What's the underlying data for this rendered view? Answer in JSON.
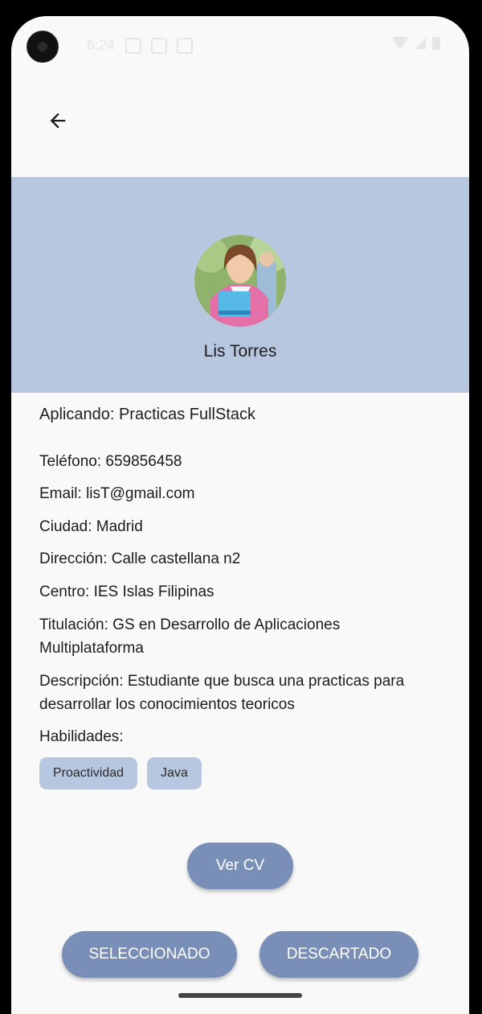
{
  "status_bar": {
    "time": "6:24"
  },
  "profile": {
    "name": "Lis Torres",
    "applying": "Aplicando: Practicas FullStack"
  },
  "details": {
    "phone": "Teléfono: 659856458",
    "email": "Email: lisT@gmail.com",
    "city": "Ciudad: Madrid",
    "address": "Dirección: Calle castellana n2",
    "center": "Centro: IES Islas Filipinas",
    "degree": "Titulación: GS en Desarrollo de Aplicaciones Multiplataforma",
    "description": "Descripción: Estudiante que busca una practicas para desarrollar los conocimientos teoricos",
    "skills_label": "Habilidades:"
  },
  "skills": [
    "Proactividad",
    "Java"
  ],
  "actions": {
    "view_cv": "Ver CV",
    "selected": "SELECCIONADO",
    "discarded": "DESCARTADO"
  },
  "colors": {
    "header_band": "#b7c7df",
    "button": "#7a8fb8",
    "chip": "#b7c7df"
  },
  "icons": {
    "back": "arrow-back-icon"
  }
}
